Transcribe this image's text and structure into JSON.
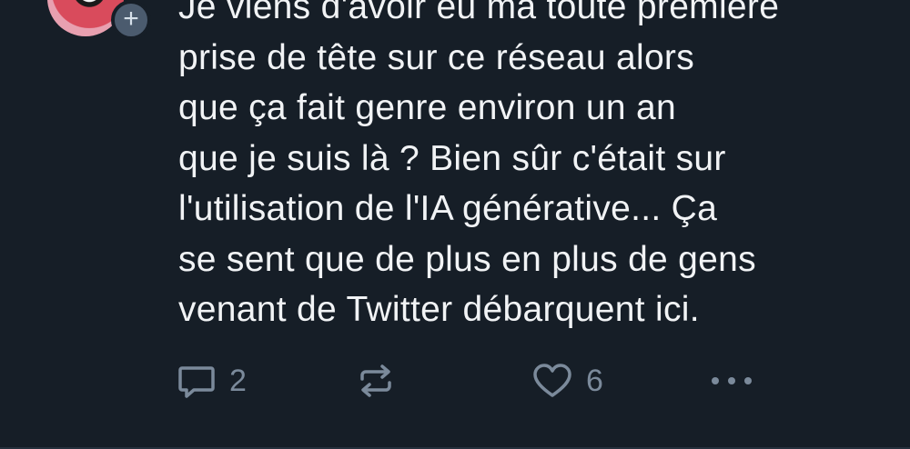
{
  "post": {
    "avatar_badge": "+",
    "text_lines": [
      "Je viens d'avoir eu ma toute première",
      "prise de tête sur ce réseau alors",
      "que ça fait genre environ un an",
      "que je suis là ? Bien sûr c'était sur",
      "l'utilisation de l'IA générative... Ça",
      "se sent que de plus en plus de gens",
      "venant de Twitter débarquent ici."
    ],
    "actions": {
      "reply_icon": "speech-bubble-icon",
      "reply_count": "2",
      "repost_icon": "repost-arrows-icon",
      "like_icon": "heart-icon",
      "like_count": "6",
      "more_icon": "ellipsis-icon"
    }
  },
  "colors": {
    "background": "#161e27",
    "text": "#f1f3f5",
    "icon": "#7b8a9b"
  }
}
